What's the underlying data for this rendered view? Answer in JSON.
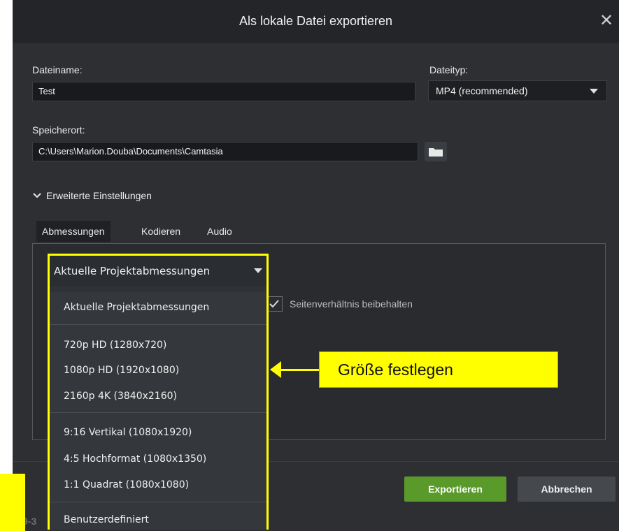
{
  "dialog": {
    "title": "Als lokale Datei exportieren"
  },
  "filename": {
    "label": "Dateiname:",
    "value": "Test"
  },
  "filetype": {
    "label": "Dateityp:",
    "value": "MP4 (recommended)"
  },
  "location": {
    "label": "Speicherort:",
    "value": "C:\\Users\\Marion.Douba\\Documents\\Camtasia"
  },
  "advanced": {
    "label": "Erweiterte Einstellungen"
  },
  "tabs": [
    {
      "label": "Abmessungen"
    },
    {
      "label": "Kodieren"
    },
    {
      "label": "Audio"
    }
  ],
  "dimensions": {
    "selected": "Aktuelle Projektabmessungen",
    "options": [
      "Aktuelle Projektabmessungen",
      "720p HD (1280x720)",
      "1080p HD (1920x1080)",
      "2160p 4K (3840x2160)",
      "9:16 Vertikal (1080x1920)",
      "4:5 Hochformat (1080x1350)",
      "1:1 Quadrat (1080x1080)",
      "Benutzerdefiniert"
    ]
  },
  "keep_ratio": {
    "label": "Seitenverhältnis beibehalten"
  },
  "buttons": {
    "export": "Exportieren",
    "cancel": "Abbrechen"
  },
  "bottom_hint": "9-3",
  "callout": {
    "text": "Größe festlegen"
  },
  "colors": {
    "accent": "#5a9a2a",
    "highlight": "#ffff00"
  }
}
